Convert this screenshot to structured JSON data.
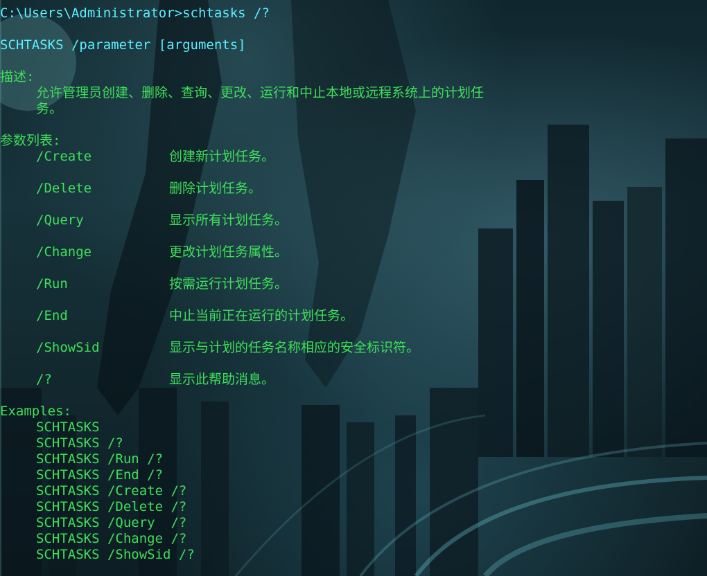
{
  "terminal": {
    "prompt_line": "C:\\Users\\Administrator>schtasks /?",
    "usage": "SCHTASKS /parameter [arguments]",
    "description_heading": "描述:",
    "description_line1": "允许管理员创建、删除、查询、更改、运行和中止本地或远程系统上的计划任",
    "description_line2": "务。",
    "params_heading": "参数列表:",
    "params": [
      {
        "name": "/Create",
        "desc": "创建新计划任务。"
      },
      {
        "name": "/Delete",
        "desc": "删除计划任务。"
      },
      {
        "name": "/Query",
        "desc": "显示所有计划任务。"
      },
      {
        "name": "/Change",
        "desc": "更改计划任务属性。"
      },
      {
        "name": "/Run",
        "desc": "按需运行计划任务。"
      },
      {
        "name": "/End",
        "desc": "中止当前正在运行的计划任务。"
      },
      {
        "name": "/ShowSid",
        "desc": "显示与计划的任务名称相应的安全标识符。"
      },
      {
        "name": "/?",
        "desc": "显示此帮助消息。"
      }
    ],
    "examples_heading": "Examples:",
    "examples": [
      "SCHTASKS",
      "SCHTASKS /?",
      "SCHTASKS /Run /?",
      "SCHTASKS /End /?",
      "SCHTASKS /Create /?",
      "SCHTASKS /Delete /?",
      "SCHTASKS /Query  /?",
      "SCHTASKS /Change /?",
      "SCHTASKS /ShowSid /?"
    ]
  },
  "colors": {
    "text": "#3ee05a",
    "prompt": "#5cf0ff",
    "background": "#0c1c22"
  }
}
